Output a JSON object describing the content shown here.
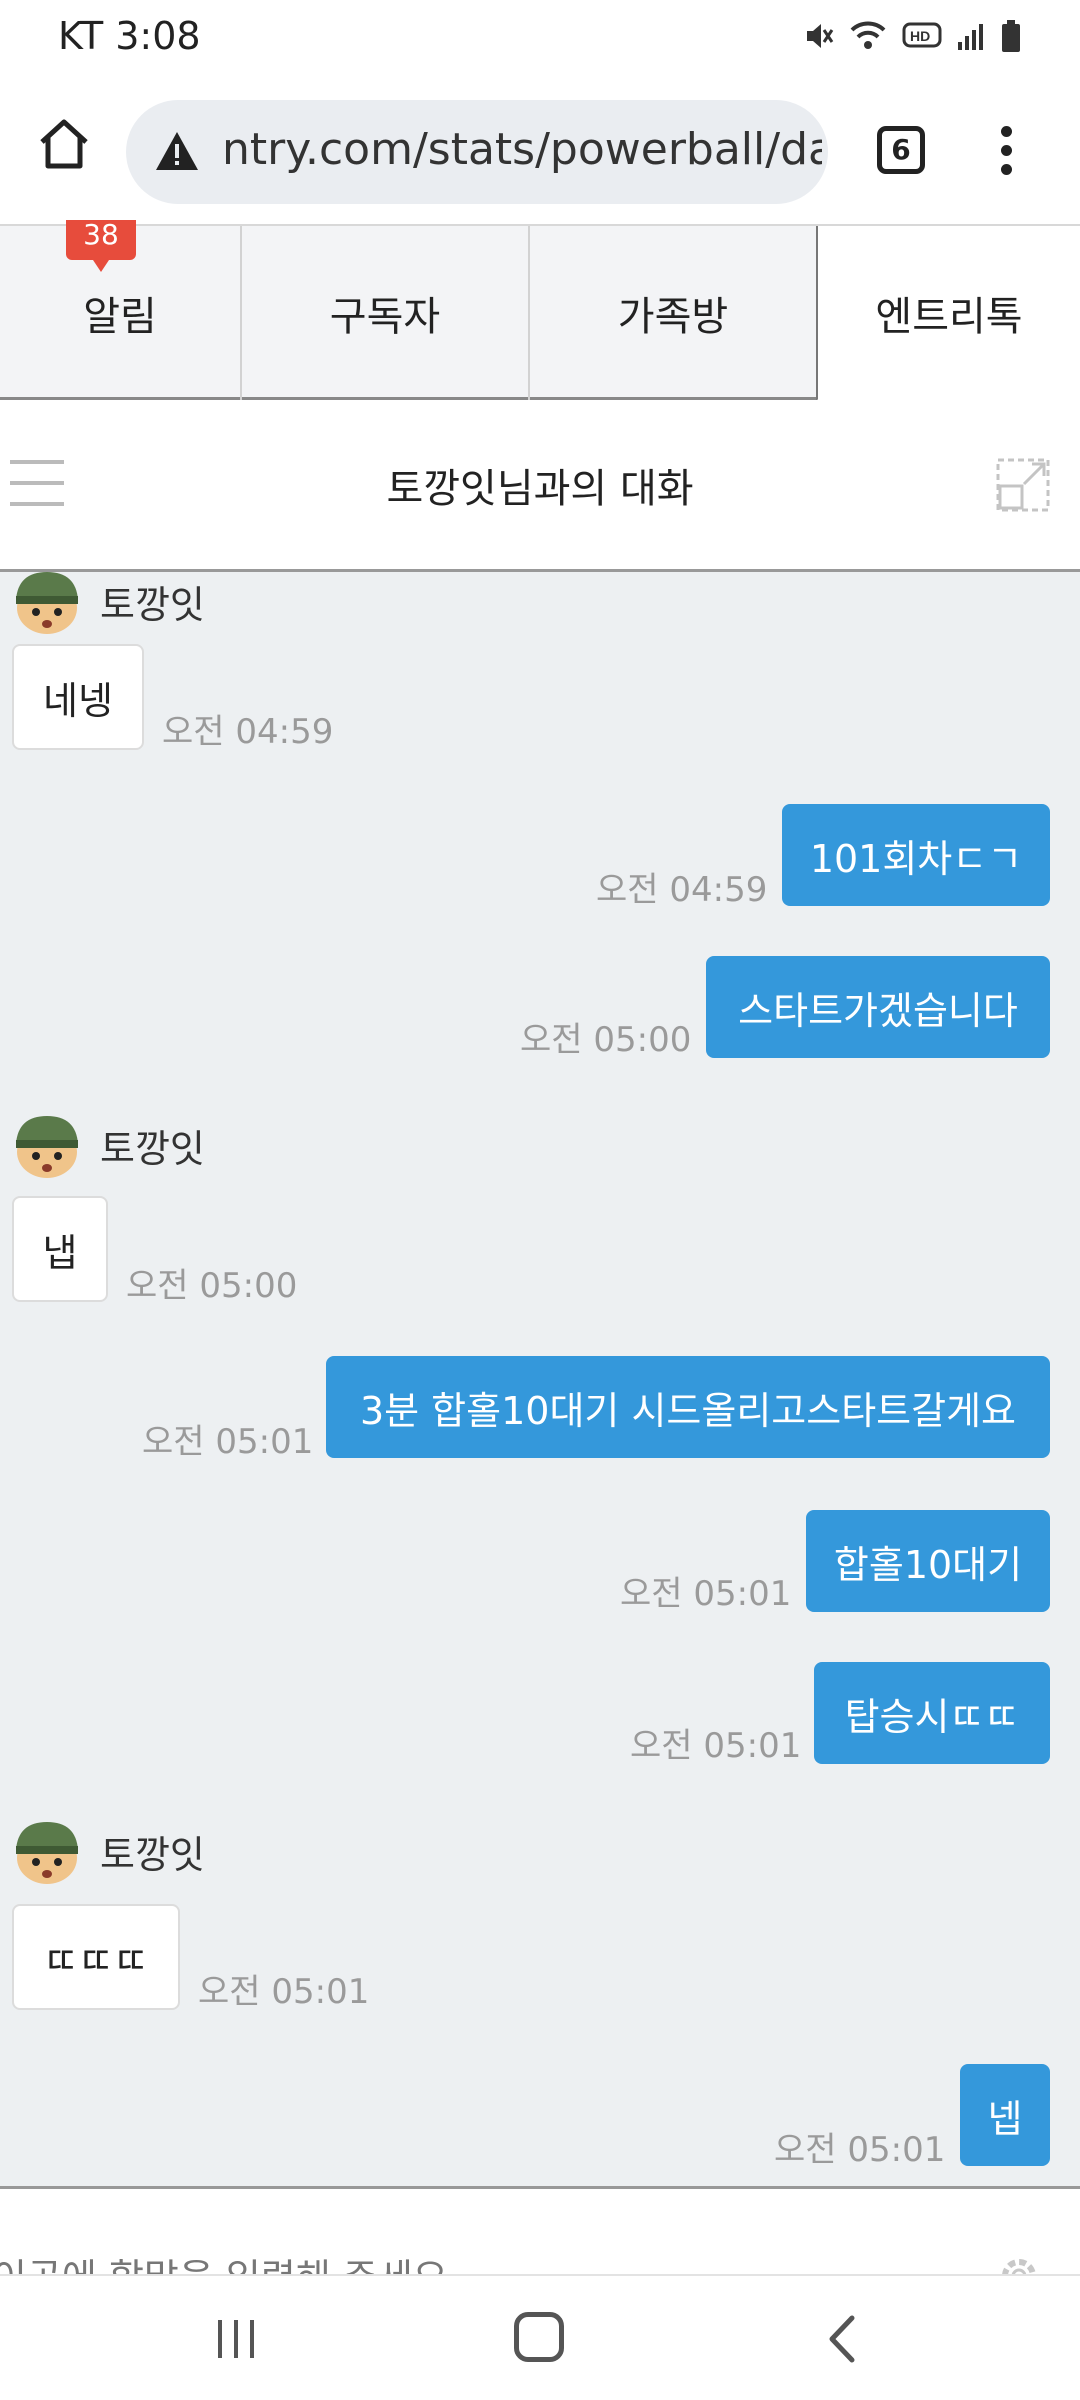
{
  "status_bar": {
    "carrier_time": "KT 3:08",
    "icons": [
      "mute-icon",
      "wifi-icon",
      "hd-icon",
      "signal-icon",
      "battery-icon"
    ]
  },
  "browser": {
    "url": "ntry.com/stats/powerball/da",
    "tab_count": "6"
  },
  "top_tabs": [
    {
      "label": "알림",
      "badge": "38",
      "active": false
    },
    {
      "label": "구독자",
      "active": false
    },
    {
      "label": "가족방",
      "active": false
    },
    {
      "label": "엔트리톡",
      "active": true
    }
  ],
  "chat": {
    "title": "토깡잇님과의 대화",
    "sender_name": "토깡잇",
    "messages": [
      {
        "dir": "in",
        "text": "네넹",
        "time": "오전 04:59"
      },
      {
        "dir": "out",
        "text": "101회차ㄷㄱ",
        "time": "오전 04:59"
      },
      {
        "dir": "out",
        "text": "스타트가겠습니다",
        "time": "오전 05:00"
      },
      {
        "dir": "in",
        "text": "냅",
        "time": "오전 05:00"
      },
      {
        "dir": "out",
        "text": "3분 합홀10대기 시드올리고스타트갈게요",
        "time": "오전 05:01"
      },
      {
        "dir": "out",
        "text": "합홀10대기",
        "time": "오전 05:01"
      },
      {
        "dir": "out",
        "text": "탑승시ㄸㄸ",
        "time": "오전 05:01"
      },
      {
        "dir": "in",
        "text": "ㄸㄸㄸ",
        "time": "오전 05:01"
      },
      {
        "dir": "out",
        "text": "넵",
        "time": "오전 05:01"
      }
    ]
  },
  "input": {
    "placeholder": "이곳에 할말을 입력해 주세요."
  },
  "colors": {
    "accent": "#3498db",
    "badge": "#e74c3c",
    "chat_bg": "#edf0f2"
  }
}
